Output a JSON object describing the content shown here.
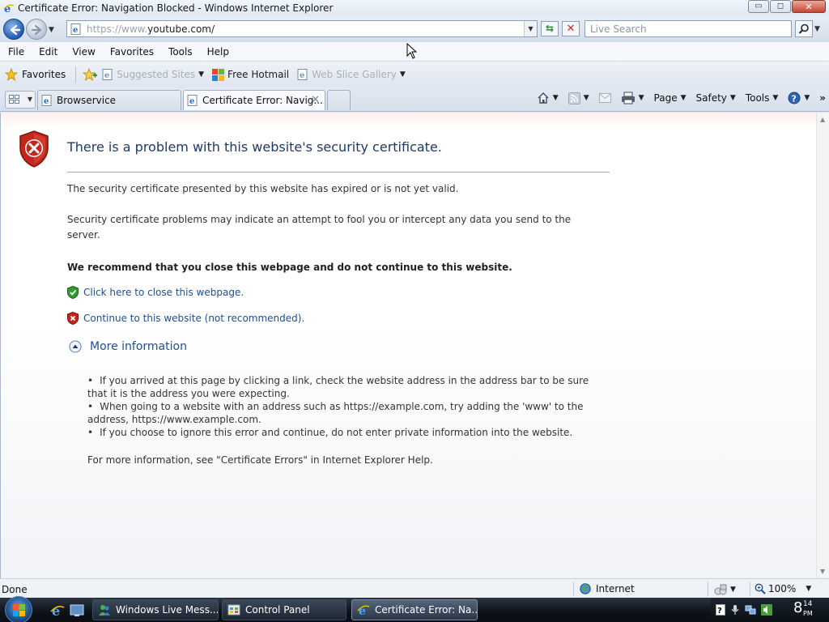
{
  "window": {
    "title": "Certificate Error: Navigation Blocked - Windows Internet Explorer",
    "minimize": "▭",
    "maximize": "◻",
    "close": "✕"
  },
  "address_bar": {
    "url_scheme": "https://www.",
    "url_host": "youtube.com/",
    "search_placeholder": "Live Search"
  },
  "menu": [
    "File",
    "Edit",
    "View",
    "Favorites",
    "Tools",
    "Help"
  ],
  "favorites_bar": {
    "favorites_label": "Favorites",
    "links": [
      {
        "label": "Suggested Sites",
        "dim": true
      },
      {
        "label": "Free Hotmail",
        "dim": false
      },
      {
        "label": "Web Slice Gallery",
        "dim": true
      }
    ]
  },
  "tabs": [
    {
      "label": "Browservice",
      "active": false
    },
    {
      "label": "Certificate Error: Navig...",
      "active": true
    }
  ],
  "command_bar": {
    "page": "Page",
    "safety": "Safety",
    "tools": "Tools"
  },
  "error_page": {
    "title": "There is a problem with this website's security certificate.",
    "para1": "The security certificate presented by this website has expired or is not yet valid.",
    "para2": "Security certificate problems may indicate an attempt to fool you or intercept any data you send to the server.",
    "recommend": "We recommend that you close this webpage and do not continue to this website.",
    "close_link": "Click here to close this webpage.",
    "continue_link": "Continue to this website (not recommended).",
    "more_info": "More information",
    "bullets": [
      "If you arrived at this page by clicking a link, check the website address in the address bar to be sure that it is the address you were expecting.",
      "When going to a website with an address such as https://example.com, try adding the 'www' to the address, https://www.example.com.",
      "If you choose to ignore this error and continue, do not enter private information into the website."
    ],
    "footer": "For more information, see \"Certificate Errors\" in Internet Explorer Help."
  },
  "status_bar": {
    "status": "Done",
    "zone": "Internet",
    "zoom": "100%"
  },
  "taskbar": {
    "buttons": [
      {
        "label": "Windows Live Mess...",
        "active": false
      },
      {
        "label": "Control Panel",
        "active": false
      },
      {
        "label": "Certificate Error: Na...",
        "active": true
      }
    ],
    "clock_hour": "8",
    "clock_minutes": "14",
    "clock_ampm": "PM"
  },
  "colors": {
    "link": "#1f4f8f",
    "title": "#1f3a68",
    "shield_red": "#c2261c",
    "shield_green": "#2f9a2f"
  }
}
